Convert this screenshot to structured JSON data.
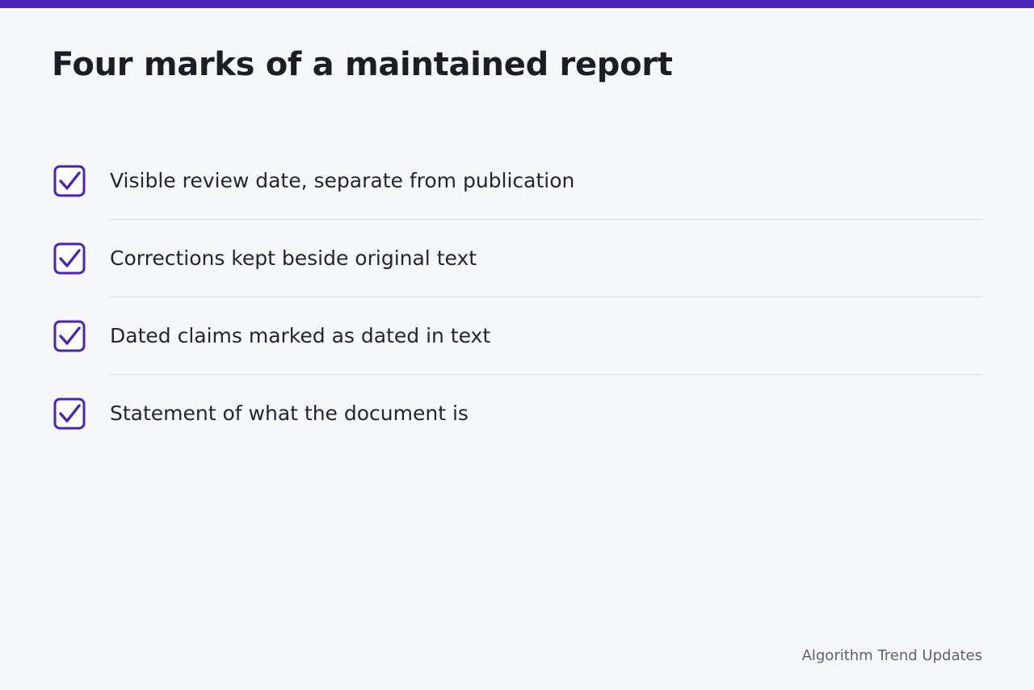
{
  "colors": {
    "accent": "#4a23b8",
    "check_bg": "#ffffff"
  },
  "title": "Four marks of a maintained report",
  "checklist": {
    "icon": "checkbox-checked-icon",
    "items": [
      {
        "label": "Visible review date, separate from publication",
        "checked": true
      },
      {
        "label": "Corrections kept beside original text",
        "checked": true
      },
      {
        "label": "Dated claims marked as dated in text",
        "checked": true
      },
      {
        "label": "Statement of what the document is",
        "checked": true
      }
    ]
  },
  "footer": "Algorithm Trend Updates"
}
